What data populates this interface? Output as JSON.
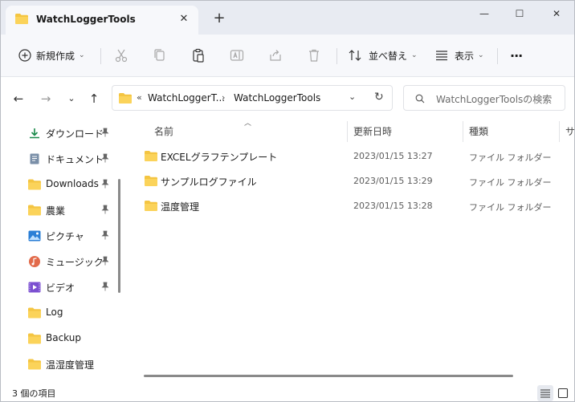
{
  "tab": {
    "title": "WatchLoggerTools",
    "close_glyph": "✕",
    "new_glyph": "+"
  },
  "window_controls": {
    "minimize": "—",
    "maximize": "☐",
    "close": "✕"
  },
  "commands": {
    "new_label": "新規作成",
    "sort_label": "並べ替え",
    "view_label": "表示",
    "more_glyph": "···"
  },
  "address": {
    "overflow": "«",
    "crumb1": "WatchLoggerT...",
    "crumb2": "WatchLoggerTools"
  },
  "search": {
    "placeholder": "WatchLoggerToolsの検索"
  },
  "nav": {
    "items": [
      {
        "label": "ダウンロード",
        "icon": "download-icon",
        "pinned": true
      },
      {
        "label": "ドキュメント",
        "icon": "document-icon",
        "pinned": true
      },
      {
        "label": "Downloads",
        "icon": "folder-icon",
        "pinned": true
      },
      {
        "label": "農業",
        "icon": "folder-icon",
        "pinned": true
      },
      {
        "label": "ピクチャ",
        "icon": "pictures-icon",
        "pinned": true
      },
      {
        "label": "ミュージック",
        "icon": "music-icon",
        "pinned": true
      },
      {
        "label": "ビデオ",
        "icon": "video-icon",
        "pinned": true
      },
      {
        "label": "Log",
        "icon": "folder-icon",
        "pinned": false
      },
      {
        "label": "Backup",
        "icon": "folder-icon",
        "pinned": false
      },
      {
        "label": "温湿度管理",
        "icon": "folder-icon",
        "pinned": false
      }
    ]
  },
  "columns": {
    "name": "名前",
    "modified": "更新日時",
    "type": "種類",
    "size": "サ"
  },
  "files": [
    {
      "name": "EXCELグラフテンプレート",
      "modified": "2023/01/15 13:27",
      "type": "ファイル フォルダー"
    },
    {
      "name": "サンプルログファイル",
      "modified": "2023/01/15 13:29",
      "type": "ファイル フォルダー"
    },
    {
      "name": "温度管理",
      "modified": "2023/01/15 13:28",
      "type": "ファイル フォルダー"
    }
  ],
  "status": {
    "item_count": "3 個の項目"
  },
  "colors": {
    "folder": "#f4c542",
    "accent": "#0067c0"
  }
}
